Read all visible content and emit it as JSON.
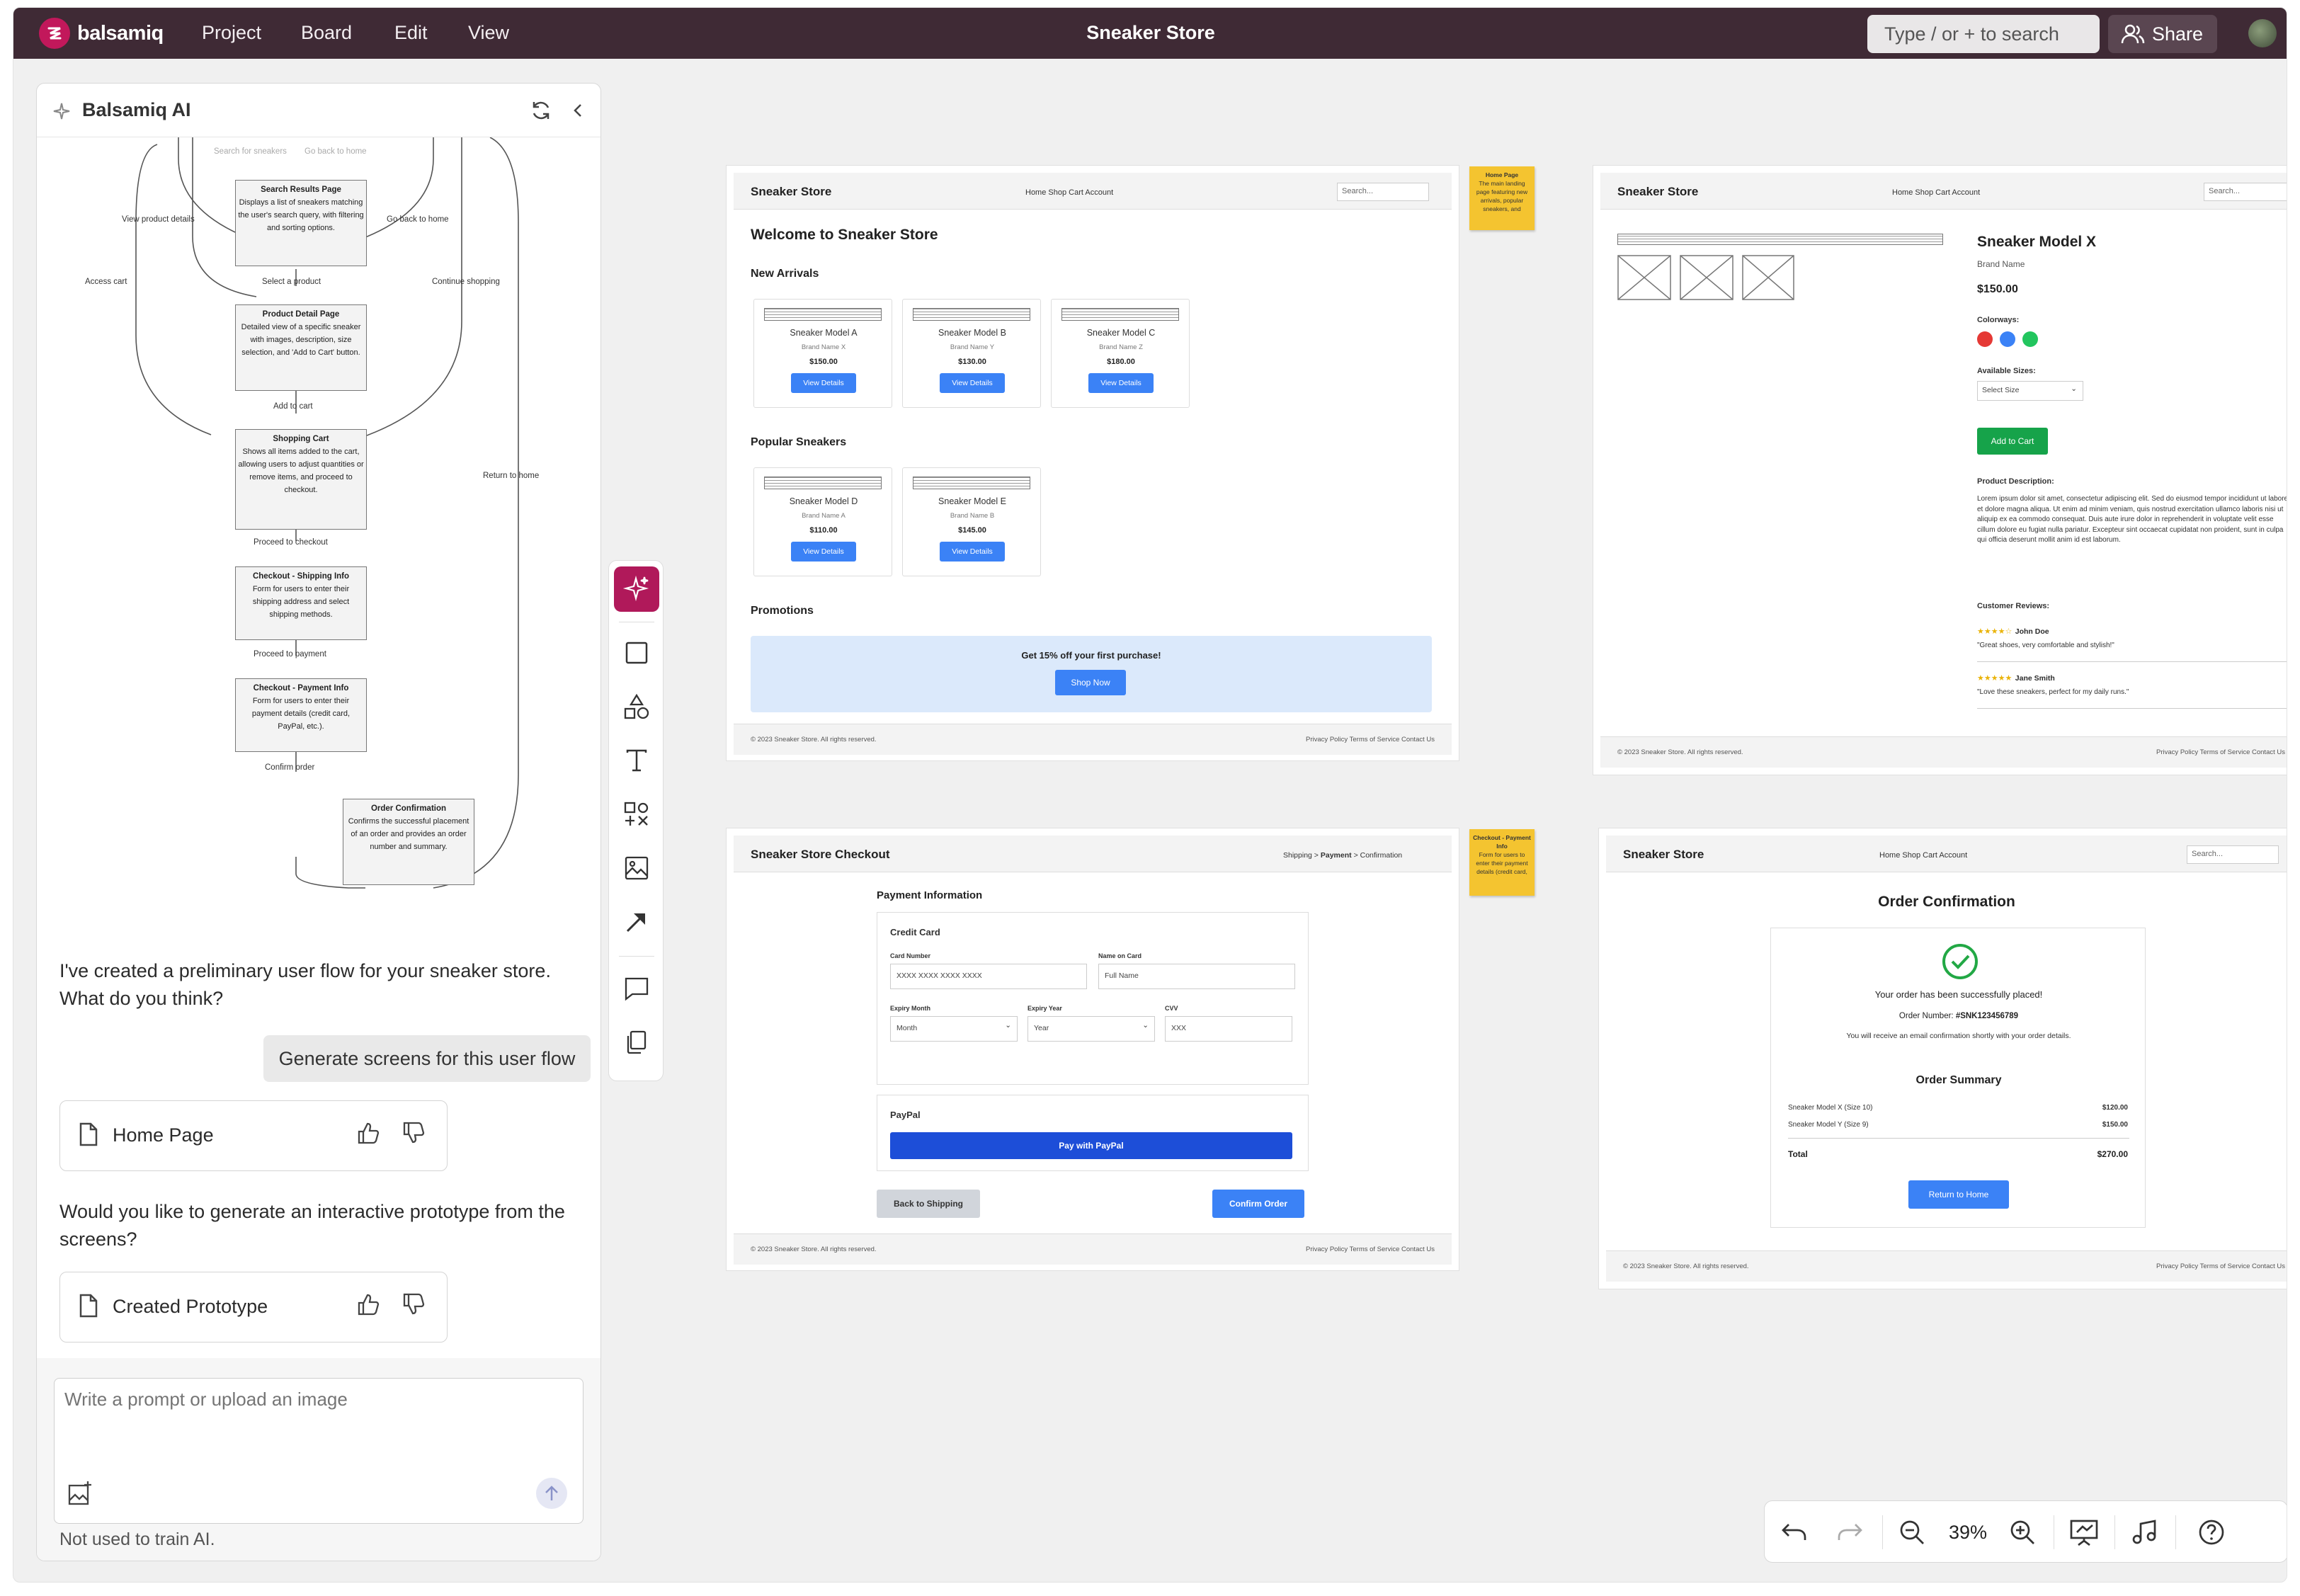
{
  "app": {
    "brand": "balsamiq",
    "menu": [
      "Project",
      "Board",
      "Edit",
      "View"
    ],
    "doc_title": "Sneaker Store",
    "search_placeholder": "Type / or + to search",
    "share_label": "Share"
  },
  "ai_panel": {
    "title": "Balsamiq AI",
    "flow": {
      "top_labels": [
        "Search for sneakers",
        "Go back to home"
      ],
      "boxes": [
        {
          "title": "Search Results Page",
          "text": "Displays a list of sneakers matching the user's search query, with filtering and sorting options."
        },
        {
          "title": "Product Detail Page",
          "text": "Detailed view of a specific sneaker with images, description, size selection, and 'Add to Cart' button."
        },
        {
          "title": "Shopping Cart",
          "text": "Shows all items added to the cart, allowing users to adjust quantities or remove items, and proceed to checkout."
        },
        {
          "title": "Checkout - Shipping Info",
          "text": "Form for users to enter their shipping address and select shipping methods."
        },
        {
          "title": "Checkout - Payment Info",
          "text": "Form for users to enter their payment details (credit card, PayPal, etc.)."
        },
        {
          "title": "Order Confirmation",
          "text": "Confirms the successful placement of an order and provides an order number and summary."
        }
      ],
      "labels": {
        "view_details": "View product details",
        "go_back": "Go back to home",
        "access_cart": "Access cart",
        "select_product": "Select a product",
        "continue_shopping": "Continue shopping",
        "add_to_cart": "Add to cart",
        "return_home": "Return to home",
        "proceed_checkout": "Proceed to checkout",
        "proceed_payment": "Proceed to payment",
        "confirm_order": "Confirm order"
      }
    },
    "message1": "I've created a preliminary user flow for your sneaker store. What do you think?",
    "user_message": "Generate screens for this user flow",
    "card1": "Home Page",
    "message2": "Would you like to generate an interactive prototype from the screens?",
    "card2": "Created Prototype",
    "prompt_placeholder": "Write a prompt or upload an image",
    "disclaimer": "Not used to train AI."
  },
  "home_mock": {
    "brand": "Sneaker Store",
    "nav": "Home Shop Cart Account",
    "search": "Search...",
    "welcome": "Welcome to Sneaker Store",
    "new_arrivals": "New Arrivals",
    "popular": "Popular Sneakers",
    "promotions": "Promotions",
    "promo_text": "Get 15% off your first purchase!",
    "shop_now": "Shop Now",
    "view_details": "View Details",
    "products_new": [
      {
        "name": "Sneaker Model A",
        "brand": "Brand Name X",
        "price": "$150.00"
      },
      {
        "name": "Sneaker Model B",
        "brand": "Brand Name Y",
        "price": "$130.00"
      },
      {
        "name": "Sneaker Model C",
        "brand": "Brand Name Z",
        "price": "$180.00"
      }
    ],
    "products_popular": [
      {
        "name": "Sneaker Model D",
        "brand": "Brand Name A",
        "price": "$110.00"
      },
      {
        "name": "Sneaker Model E",
        "brand": "Brand Name B",
        "price": "$145.00"
      }
    ],
    "footer_left": "© 2023 Sneaker Store. All rights reserved.",
    "footer_right": "Privacy Policy Terms of Service Contact Us",
    "note_title": "Home Page",
    "note_text": "The main landing page featuring new arrivals, popular sneakers, and"
  },
  "detail_mock": {
    "brand": "Sneaker Store",
    "nav": "Home Shop Cart Account",
    "search": "Search...",
    "product": "Sneaker Model X",
    "brand_name": "Brand Name",
    "price": "$150.00",
    "colorways_label": "Colorways:",
    "colors": [
      "#e53935",
      "#3b82f6",
      "#22c55e"
    ],
    "sizes_label": "Available Sizes:",
    "select_size": "Select Size",
    "add_to_cart": "Add to Cart",
    "desc_label": "Product Description:",
    "desc": "Lorem ipsum dolor sit amet, consectetur adipiscing elit. Sed do eiusmod tempor incididunt ut labore et dolore magna aliqua. Ut enim ad minim veniam, quis nostrud exercitation ullamco laboris nisi ut aliquip ex ea commodo consequat. Duis aute irure dolor in reprehenderit in voluptate velit esse cillum dolore eu fugiat nulla pariatur. Excepteur sint occaecat cupidatat non proident, sunt in culpa qui officia deserunt mollit anim id est laborum.",
    "reviews_label": "Customer Reviews:",
    "reviews": [
      {
        "stars": "★★★★☆",
        "name": "John Doe",
        "text": "\"Great shoes, very comfortable and stylish!\""
      },
      {
        "stars": "★★★★★",
        "name": "Jane Smith",
        "text": "\"Love these sneakers, perfect for my daily runs.\""
      }
    ],
    "footer_left": "© 2023 Sneaker Store. All rights reserved.",
    "footer_right": "Privacy Policy Terms of Service Contact Us"
  },
  "checkout_mock": {
    "brand": "Sneaker Store Checkout",
    "crumb_a": "Shipping",
    "crumb_b": "Payment",
    "crumb_c": "Confirmation",
    "sep": ">",
    "section": "Payment Information",
    "credit_card": "Credit Card",
    "card_number_label": "Card Number",
    "card_number": "XXXX XXXX XXXX XXXX",
    "name_label": "Name on Card",
    "name_value": "Full Name",
    "exp_month_label": "Expiry Month",
    "exp_month": "Month",
    "exp_year_label": "Expiry Year",
    "exp_year": "Year",
    "cvv_label": "CVV",
    "cvv": "XXX",
    "paypal": "PayPal",
    "pay_paypal": "Pay with PayPal",
    "back": "Back to Shipping",
    "confirm": "Confirm Order",
    "footer_left": "© 2023 Sneaker Store. All rights reserved.",
    "footer_right": "Privacy Policy Terms of Service Contact Us",
    "note_title": "Checkout - Payment Info",
    "note_text": "Form for users to enter their payment details (credit card,"
  },
  "confirm_mock": {
    "brand": "Sneaker Store",
    "nav": "Home Shop Cart Account",
    "search": "Search...",
    "title": "Order Confirmation",
    "placed": "Your order has been successfully placed!",
    "order_label": "Order Number:",
    "order_number": "#SNK123456789",
    "email_note": "You will receive an email confirmation shortly with your order details.",
    "summary": "Order Summary",
    "items": [
      {
        "name": "Sneaker Model X (Size 10)",
        "price": "$120.00"
      },
      {
        "name": "Sneaker Model Y (Size 9)",
        "price": "$150.00"
      }
    ],
    "total_label": "Total",
    "total": "$270.00",
    "return_home": "Return to Home",
    "footer_left": "© 2023 Sneaker Store. All rights reserved.",
    "footer_right": "Privacy Policy Terms of Service Contact Us"
  },
  "zoom": {
    "level": "39%"
  },
  "colors": {
    "topbar": "#3f2a35",
    "accent": "#b0195a",
    "link_blue": "#3b82f6",
    "paypal": "#1d4ed8",
    "add_green": "#16a34a",
    "note": "#f4c430"
  }
}
